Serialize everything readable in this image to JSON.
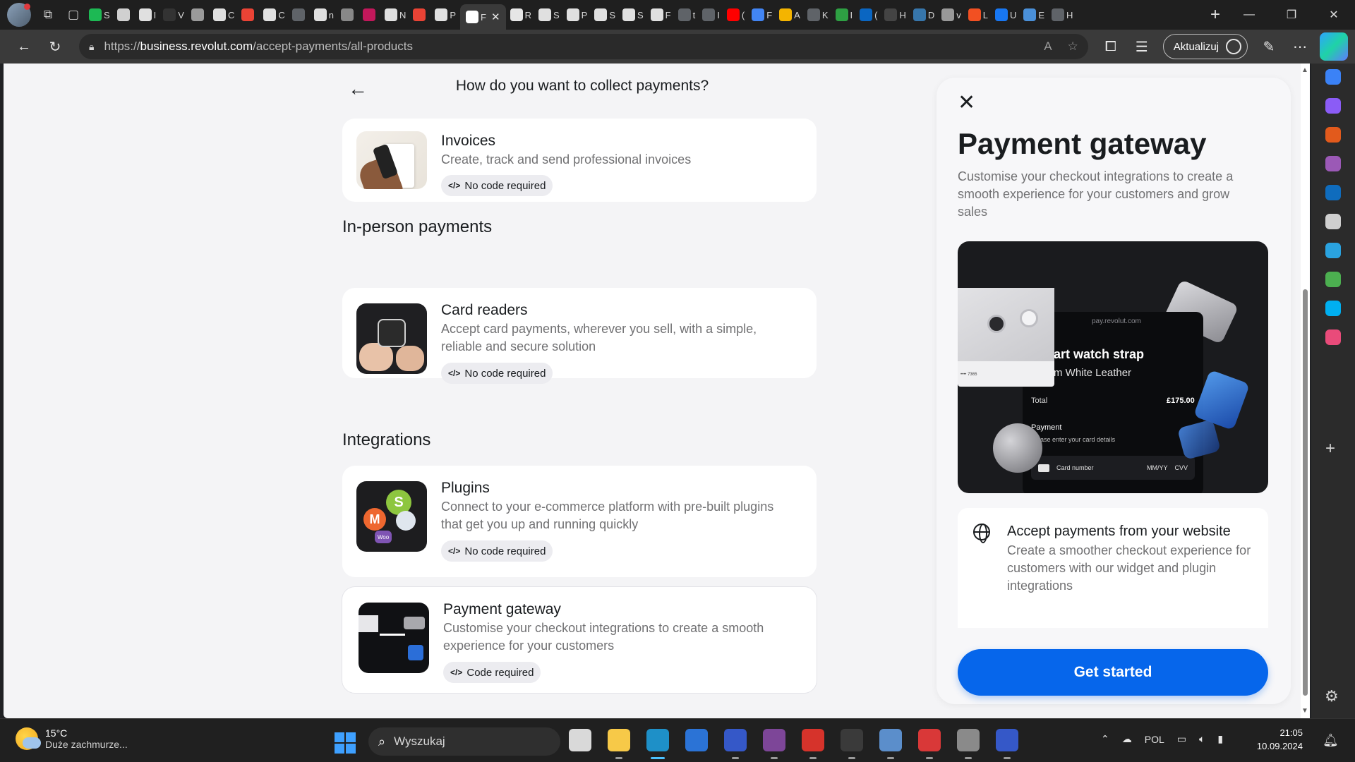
{
  "browser": {
    "tabs": [
      {
        "label": "S",
        "color": "#1db954"
      },
      {
        "label": "",
        "color": "#d0d0d0"
      },
      {
        "label": "I",
        "color": "#e0e0e0"
      },
      {
        "label": "V",
        "color": "#333333"
      },
      {
        "label": "",
        "color": "#9a9a9a"
      },
      {
        "label": "C",
        "color": "#e0e0e0"
      },
      {
        "label": "",
        "color": "#ea4335"
      },
      {
        "label": "C",
        "color": "#e0e0e0"
      },
      {
        "label": "",
        "color": "#5f6368"
      },
      {
        "label": "n",
        "color": "#e0e0e0"
      },
      {
        "label": "",
        "color": "#888888"
      },
      {
        "label": "",
        "color": "#c2185b"
      },
      {
        "label": "N",
        "color": "#e0e0e0"
      },
      {
        "label": "",
        "color": "#ea4335"
      },
      {
        "label": "P",
        "color": "#e0e0e0"
      }
    ],
    "active_tab": {
      "label": "F"
    },
    "tabs_after": [
      {
        "label": "R",
        "color": "#e6e6e6"
      },
      {
        "label": "S",
        "color": "#e0e0e0"
      },
      {
        "label": "P",
        "color": "#e0e0e0"
      },
      {
        "label": "S",
        "color": "#e0e0e0"
      },
      {
        "label": "S",
        "color": "#e0e0e0"
      },
      {
        "label": "F",
        "color": "#e0e0e0"
      },
      {
        "label": "t",
        "color": "#5f6368"
      },
      {
        "label": "I",
        "color": "#5f6368"
      },
      {
        "label": "(",
        "color": "#ff0000"
      },
      {
        "label": "F",
        "color": "#4285f4"
      },
      {
        "label": "A",
        "color": "#f4b400"
      },
      {
        "label": "K",
        "color": "#5f6368"
      },
      {
        "label": "I",
        "color": "#2ea043"
      },
      {
        "label": "(",
        "color": "#0a66c2"
      },
      {
        "label": "H",
        "color": "#444444"
      },
      {
        "label": "D",
        "color": "#3776ab"
      },
      {
        "label": "v",
        "color": "#999999"
      },
      {
        "label": "L",
        "color": "#f25022"
      },
      {
        "label": "U",
        "color": "#1877f2"
      },
      {
        "label": "E",
        "color": "#4a90d9"
      },
      {
        "label": "H",
        "color": "#5f6368"
      }
    ],
    "url_prefix": "https://",
    "url_host": "business.revolut.com",
    "url_path": "/accept-payments/all-products",
    "update_label": "Aktualizuj"
  },
  "page": {
    "title": "How do you want to collect payments?",
    "cards_top": [
      {
        "title": "Invoices",
        "desc": "Create, track and send professional invoices",
        "chip": "No code required"
      }
    ],
    "section_in_person": "In-person payments",
    "card_readers": {
      "title": "Card readers",
      "desc": "Accept card payments, wherever you sell, with a simple, reliable and secure solution",
      "chip": "No code required"
    },
    "section_integrations": "Integrations",
    "plugins": {
      "title": "Plugins",
      "desc": "Connect to your e-commerce platform with pre-built plugins that get you up and running quickly",
      "chip": "No code required",
      "woo_label": "Woo"
    },
    "gateway": {
      "title": "Payment gateway",
      "desc": "Customise your checkout integrations to create a smooth experience for your customers",
      "chip": "Code required"
    }
  },
  "panel": {
    "title": "Payment gateway",
    "desc": "Customise your checkout integrations to create a smooth experience for your customers and grow sales",
    "hero": {
      "pay_domain": "pay.revolut.com",
      "product": "art watch strap",
      "variant": "m White Leather",
      "total_label": "Total",
      "total_value": "£175.00",
      "payment_label": "Payment",
      "payment_hint": "Please enter your card details",
      "card_number": "Card number",
      "mm_yy": "MM/YY",
      "cvv": "CVV",
      "saved_card": "•••• 7365"
    },
    "feature": {
      "title": "Accept payments from your website",
      "desc": "Create a smoother checkout experience for customers with our widget and plugin integrations"
    },
    "cta": "Get started"
  },
  "taskbar": {
    "temperature": "15°C",
    "weather": "Duże zachmurze...",
    "search_placeholder": "Wyszukaj",
    "language": "POL",
    "time": "21:05",
    "date": "10.09.2024",
    "apps": [
      {
        "name": "task-view",
        "color": "#d9d9d9",
        "state": ""
      },
      {
        "name": "file-explorer",
        "color": "#f7c948",
        "state": "run"
      },
      {
        "name": "edge",
        "color": "#1e90c8",
        "state": "act"
      },
      {
        "name": "store",
        "color": "#2b73d6",
        "state": ""
      },
      {
        "name": "save-app",
        "color": "#3558c8",
        "state": "run"
      },
      {
        "name": "tor-browser",
        "color": "#7d4698",
        "state": "run"
      },
      {
        "name": "red-app",
        "color": "#d6332b",
        "state": "run"
      },
      {
        "name": "terminal",
        "color": "#3a3a3a",
        "state": "run"
      },
      {
        "name": "virtualbox",
        "color": "#5b8ecb",
        "state": "run"
      },
      {
        "name": "pdf-app",
        "color": "#d93838",
        "state": "run"
      },
      {
        "name": "settings",
        "color": "#8a8a8a",
        "state": "run"
      },
      {
        "name": "save-app-2",
        "color": "#3558c8",
        "state": "run"
      }
    ]
  },
  "sidebar_icons": [
    {
      "name": "tag-icon",
      "color": "#3b82f6"
    },
    {
      "name": "copilot-icon",
      "color": "#8b5cf6"
    },
    {
      "name": "tools-icon",
      "color": "#e25a1c"
    },
    {
      "name": "games-icon",
      "color": "#9b59b6"
    },
    {
      "name": "outlook-icon",
      "color": "#0f6cbd"
    },
    {
      "name": "search-icon",
      "color": "#cfcfcf"
    },
    {
      "name": "telegram-icon",
      "color": "#2aa3e0"
    },
    {
      "name": "tree-icon",
      "color": "#4caf50"
    },
    {
      "name": "skype-icon",
      "color": "#00aff0"
    },
    {
      "name": "app-icon",
      "color": "#e94b7a"
    }
  ]
}
